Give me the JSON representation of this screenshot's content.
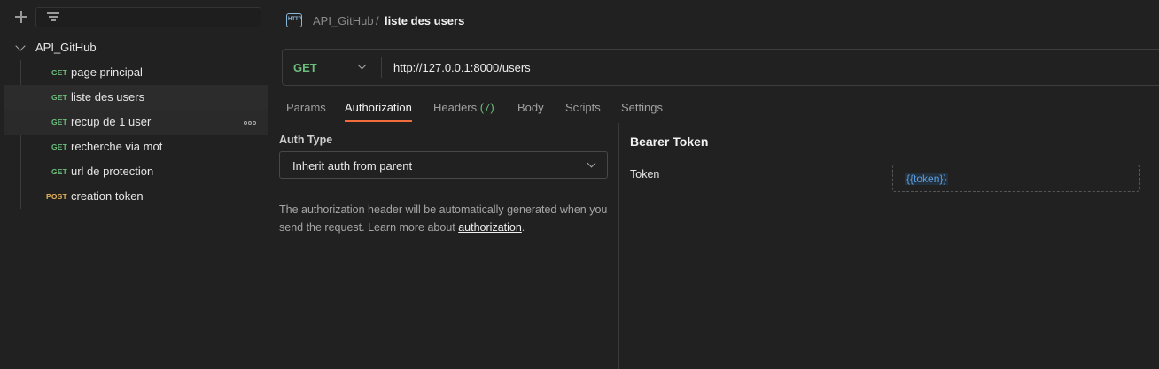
{
  "sidebar": {
    "collection": "API_GitHub",
    "requests": [
      {
        "method": "GET",
        "name": "page principal"
      },
      {
        "method": "GET",
        "name": "liste des users"
      },
      {
        "method": "GET",
        "name": "recup de 1 user"
      },
      {
        "method": "GET",
        "name": "recherche via mot"
      },
      {
        "method": "GET",
        "name": "url de protection"
      },
      {
        "method": "POST",
        "name": "creation token"
      }
    ]
  },
  "breadcrumb": {
    "icon_text": "HTTP",
    "parent": "API_GitHub",
    "separator": "/",
    "current": "liste des users"
  },
  "request": {
    "method": "GET",
    "url": "http://127.0.0.1:8000/users"
  },
  "tabs": {
    "params": "Params",
    "authorization": "Authorization",
    "headers": "Headers",
    "headers_count": "(7)",
    "body": "Body",
    "scripts": "Scripts",
    "settings": "Settings"
  },
  "auth": {
    "type_label": "Auth Type",
    "type_value": "Inherit auth from parent",
    "description": "The authorization header will be automatically generated when you send the request. Learn more about ",
    "link": "authorization",
    "period": ".",
    "bearer_title": "Bearer Token",
    "token_label": "Token",
    "token_value": "{{token}}"
  },
  "colors": {
    "get": "#6bbd7c",
    "post": "#e3b15c",
    "accent": "#f26b3a",
    "variable": "#5b9fe0"
  }
}
